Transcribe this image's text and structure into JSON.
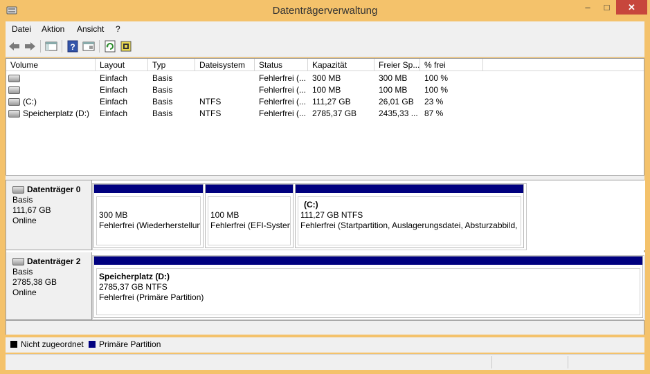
{
  "window": {
    "title": "Datenträgerverwaltung",
    "minimize": "–",
    "maximize": "□",
    "close": "✕"
  },
  "menu": [
    "Datei",
    "Aktion",
    "Ansicht",
    "?"
  ],
  "toolbar": [
    "back-icon",
    "forward-icon",
    "console-tree-icon",
    "help-icon",
    "properties-icon",
    "refresh-icon",
    "rescan-icon"
  ],
  "volume_list": {
    "columns": [
      "Volume",
      "Layout",
      "Typ",
      "Dateisystem",
      "Status",
      "Kapazität",
      "Freier Sp...",
      "% frei"
    ],
    "rows": [
      [
        "",
        "Einfach",
        "Basis",
        "",
        "Fehlerfrei (...",
        "300 MB",
        "300 MB",
        "100 %"
      ],
      [
        "",
        "Einfach",
        "Basis",
        "",
        "Fehlerfrei (...",
        "100 MB",
        "100 MB",
        "100 %"
      ],
      [
        "(C:)",
        "Einfach",
        "Basis",
        "NTFS",
        "Fehlerfrei (...",
        "111,27 GB",
        "26,01 GB",
        "23 %"
      ],
      [
        "Speicherplatz (D:)",
        "Einfach",
        "Basis",
        "NTFS",
        "Fehlerfrei (...",
        "2785,37 GB",
        "2435,33 ...",
        "87 %"
      ]
    ]
  },
  "disks": [
    {
      "name": "Datenträger 0",
      "type": "Basis",
      "size": "111,67 GB",
      "state": "Online",
      "partitions": [
        {
          "title": "",
          "size": "300 MB",
          "status": "Fehlerfrei (Wiederherstellun"
        },
        {
          "title": "",
          "size": "100 MB",
          "status": "Fehlerfrei (EFI-System"
        },
        {
          "title": "(C:)",
          "size": "111,27 GB NTFS",
          "status": "Fehlerfrei (Startpartition, Auslagerungsdatei, Absturzabbild, I"
        }
      ]
    },
    {
      "name": "Datenträger 2",
      "type": "Basis",
      "size": "2785,38 GB",
      "state": "Online",
      "partitions": [
        {
          "title": "Speicherplatz  (D:)",
          "size": "2785,37 GB NTFS",
          "status": "Fehlerfrei (Primäre Partition)"
        }
      ]
    }
  ],
  "legend": [
    {
      "label": "Nicht zugeordnet",
      "color": "#000000"
    },
    {
      "label": "Primäre Partition",
      "color": "#00007f"
    }
  ]
}
